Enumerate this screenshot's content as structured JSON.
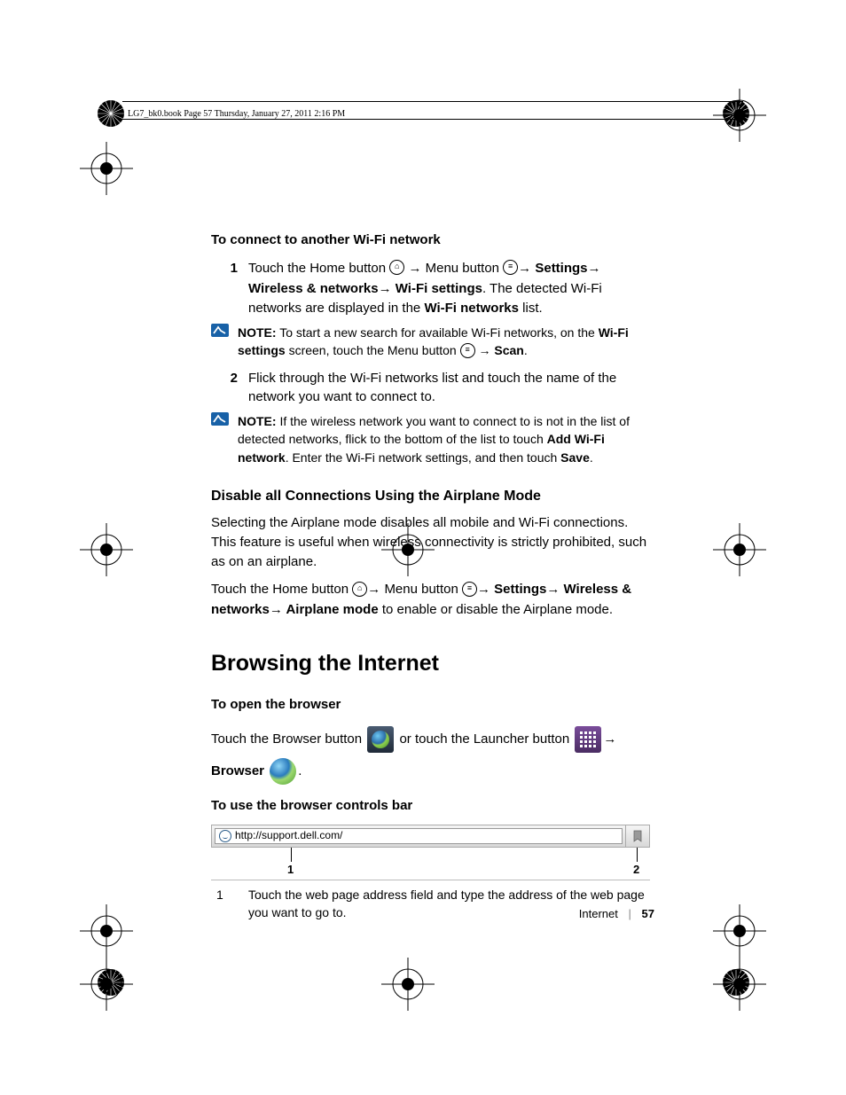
{
  "header_tag": "LG7_bk0.book  Page 57  Thursday, January 27, 2011  2:16 PM",
  "section1": {
    "title": "To connect to another Wi-Fi network",
    "step1_num": "1",
    "step1_a": "Touch the Home button ",
    "step1_b": " Menu button ",
    "step1_settings": "Settings",
    "step1_wireless": "Wireless & networks",
    "step1_wifi": " Wi-Fi settings",
    "step1_c": ". The detected Wi-Fi networks are displayed in the ",
    "step1_wifinet": "Wi-Fi networks",
    "step1_d": " list.",
    "note1_label": "NOTE:",
    "note1_a": " To start a new search for available Wi-Fi networks, on the ",
    "note1_wifiset": "Wi-Fi settings",
    "note1_b": " screen, touch the Menu button ",
    "note1_scan": "Scan",
    "note1_c": ".",
    "step2_num": "2",
    "step2": "Flick through the Wi-Fi networks list and touch the name of the network you want to connect to.",
    "note2_label": "NOTE:",
    "note2_a": " If the wireless network you want to connect to is not in the list of detected networks, flick to the bottom of the list to touch ",
    "note2_add": "Add Wi-Fi network",
    "note2_b": ". Enter the Wi-Fi network settings, and then touch ",
    "note2_save": "Save",
    "note2_c": "."
  },
  "section2": {
    "title": "Disable all Connections Using the Airplane Mode",
    "p1": "Selecting the Airplane mode disables all mobile and Wi-Fi connections. This feature is useful when wireless connectivity is strictly prohibited, such as on an airplane.",
    "p2_a": "Touch the Home button ",
    "p2_b": " Menu button ",
    "p2_settings": "Settings",
    "p2_wireless": "Wireless & networks",
    "p2_airplane": " Airplane mode",
    "p2_c": " to enable or disable the Airplane mode."
  },
  "chapter": "Browsing the Internet",
  "section3": {
    "title": "To open the browser",
    "p_a": "Touch the Browser button ",
    "p_b": " or touch the Launcher button ",
    "p_browser": "Browser",
    "p_c": "."
  },
  "section4": {
    "title": "To use the browser controls bar",
    "url": "http://support.dell.com/",
    "callout1": "1",
    "callout2": "2",
    "desc1_num": "1",
    "desc1": "Touch the web page address field and type the address of the web page you want to go to."
  },
  "footer": {
    "section": "Internet",
    "page": "57"
  },
  "arrow": "→"
}
